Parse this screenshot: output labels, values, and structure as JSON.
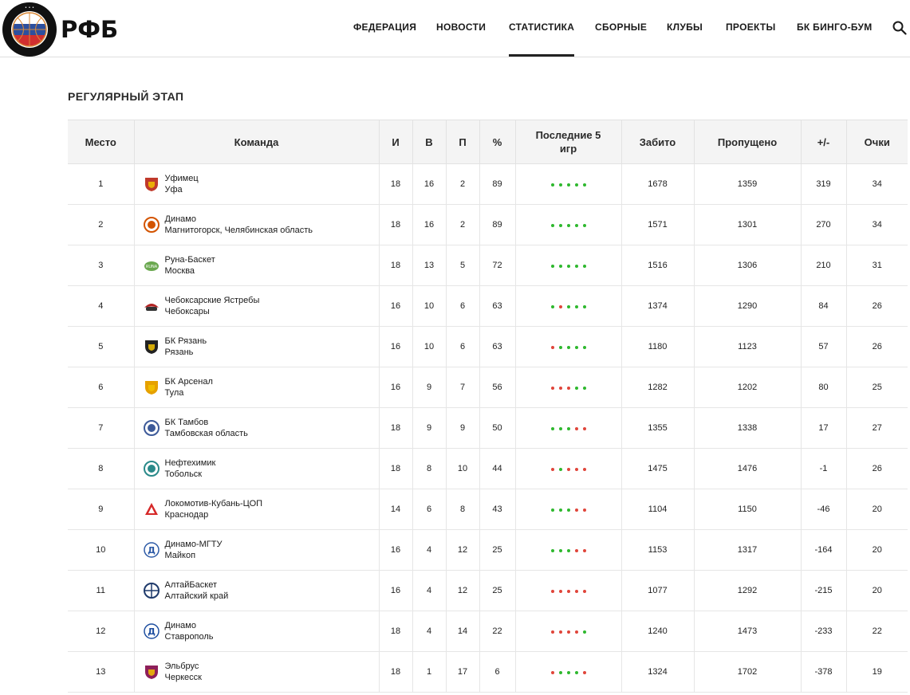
{
  "colors": {
    "win": "#2eb82e",
    "loss": "#e0453a",
    "header_bg": "#f4f4f4",
    "accent": "#222222"
  },
  "header": {
    "logo_text": "РФБ",
    "logo_seal_text": "РОССИЙСКАЯ ФЕДЕРАЦИЯ БАСКЕТБОЛА 1991",
    "nav": [
      {
        "label": "ФЕДЕРАЦИЯ",
        "active": false
      },
      {
        "label": "НОВОСТИ",
        "active": false
      },
      {
        "label": "СТАТИСТИКА",
        "active": true
      },
      {
        "label": "СБОРНЫЕ",
        "active": false
      },
      {
        "label": "КЛУБЫ",
        "active": false
      },
      {
        "label": "ПРОЕКТЫ",
        "active": false
      },
      {
        "label": "БК БИНГО-БУМ",
        "active": false
      }
    ],
    "search_icon": "search-icon"
  },
  "section": {
    "title": "РЕГУЛЯРНЫЙ ЭТАП"
  },
  "table": {
    "columns": [
      "Место",
      "Команда",
      "И",
      "В",
      "П",
      "%",
      "Последние 5 игр",
      "Забито",
      "Пропущено",
      "+/-",
      "Очки"
    ],
    "rows": [
      {
        "place": "1",
        "team": "Уфимец",
        "city": "Уфа",
        "g": "18",
        "w": "16",
        "l": "2",
        "pct": "89",
        "form": [
          "W",
          "W",
          "W",
          "W",
          "W"
        ],
        "scored": "1678",
        "allowed": "1359",
        "diff": "319",
        "pts": "34"
      },
      {
        "place": "2",
        "team": "Динамо",
        "city": "Магнитогорск, Челябинская область",
        "g": "18",
        "w": "16",
        "l": "2",
        "pct": "89",
        "form": [
          "W",
          "W",
          "W",
          "W",
          "W"
        ],
        "scored": "1571",
        "allowed": "1301",
        "diff": "270",
        "pts": "34"
      },
      {
        "place": "3",
        "team": "Руна-Баскет",
        "city": "Москва",
        "g": "18",
        "w": "13",
        "l": "5",
        "pct": "72",
        "form": [
          "W",
          "W",
          "W",
          "W",
          "W"
        ],
        "scored": "1516",
        "allowed": "1306",
        "diff": "210",
        "pts": "31"
      },
      {
        "place": "4",
        "team": "Чебоксарские Ястребы",
        "city": "Чебоксары",
        "g": "16",
        "w": "10",
        "l": "6",
        "pct": "63",
        "form": [
          "W",
          "L",
          "W",
          "W",
          "W"
        ],
        "scored": "1374",
        "allowed": "1290",
        "diff": "84",
        "pts": "26"
      },
      {
        "place": "5",
        "team": "БК Рязань",
        "city": "Рязань",
        "g": "16",
        "w": "10",
        "l": "6",
        "pct": "63",
        "form": [
          "L",
          "W",
          "W",
          "W",
          "W"
        ],
        "scored": "1180",
        "allowed": "1123",
        "diff": "57",
        "pts": "26"
      },
      {
        "place": "6",
        "team": "БК Арсенал",
        "city": "Тула",
        "g": "16",
        "w": "9",
        "l": "7",
        "pct": "56",
        "form": [
          "L",
          "L",
          "L",
          "W",
          "W"
        ],
        "scored": "1282",
        "allowed": "1202",
        "diff": "80",
        "pts": "25"
      },
      {
        "place": "7",
        "team": "БК Тамбов",
        "city": "Тамбовская область",
        "g": "18",
        "w": "9",
        "l": "9",
        "pct": "50",
        "form": [
          "W",
          "W",
          "W",
          "L",
          "L"
        ],
        "scored": "1355",
        "allowed": "1338",
        "diff": "17",
        "pts": "27"
      },
      {
        "place": "8",
        "team": "Нефтехимик",
        "city": "Тобольск",
        "g": "18",
        "w": "8",
        "l": "10",
        "pct": "44",
        "form": [
          "L",
          "W",
          "L",
          "L",
          "L"
        ],
        "scored": "1475",
        "allowed": "1476",
        "diff": "-1",
        "pts": "26"
      },
      {
        "place": "9",
        "team": "Локомотив-Кубань-ЦОП",
        "city": "Краснодар",
        "g": "14",
        "w": "6",
        "l": "8",
        "pct": "43",
        "form": [
          "W",
          "W",
          "W",
          "L",
          "L"
        ],
        "scored": "1104",
        "allowed": "1150",
        "diff": "-46",
        "pts": "20"
      },
      {
        "place": "10",
        "team": "Динамо-МГТУ",
        "city": "Майкоп",
        "g": "16",
        "w": "4",
        "l": "12",
        "pct": "25",
        "form": [
          "W",
          "W",
          "W",
          "L",
          "L"
        ],
        "scored": "1153",
        "allowed": "1317",
        "diff": "-164",
        "pts": "20"
      },
      {
        "place": "11",
        "team": "АлтайБаскет",
        "city": "Алтайский край",
        "g": "16",
        "w": "4",
        "l": "12",
        "pct": "25",
        "form": [
          "L",
          "L",
          "L",
          "L",
          "L"
        ],
        "scored": "1077",
        "allowed": "1292",
        "diff": "-215",
        "pts": "20"
      },
      {
        "place": "12",
        "team": "Динамо",
        "city": "Ставрополь",
        "g": "18",
        "w": "4",
        "l": "14",
        "pct": "22",
        "form": [
          "L",
          "L",
          "L",
          "L",
          "W"
        ],
        "scored": "1240",
        "allowed": "1473",
        "diff": "-233",
        "pts": "22"
      },
      {
        "place": "13",
        "team": "Эльбрус",
        "city": "Черкесск",
        "g": "18",
        "w": "1",
        "l": "17",
        "pct": "6",
        "form": [
          "L",
          "W",
          "W",
          "W",
          "L"
        ],
        "scored": "1324",
        "allowed": "1702",
        "diff": "-378",
        "pts": "19"
      }
    ]
  },
  "team_logos": [
    {
      "icon": "ufimets-logo-icon",
      "color": "#c0392b"
    },
    {
      "icon": "dinamo-mgn-logo-icon",
      "color": "#d35400"
    },
    {
      "icon": "runa-logo-icon",
      "color": "#6aa84f"
    },
    {
      "icon": "cheboksary-hawks-logo-icon",
      "color": "#b22222"
    },
    {
      "icon": "bk-ryazan-logo-icon",
      "color": "#222222"
    },
    {
      "icon": "bk-arsenal-logo-icon",
      "color": "#e6a100"
    },
    {
      "icon": "bk-tambov-logo-icon",
      "color": "#3d5a99"
    },
    {
      "icon": "neftekhimik-logo-icon",
      "color": "#2a8a8a"
    },
    {
      "icon": "lokomotiv-kuban-logo-icon",
      "color": "#d62828"
    },
    {
      "icon": "dinamo-mgtu-logo-icon",
      "color": "#2d5aa6"
    },
    {
      "icon": "altaibasket-logo-icon",
      "color": "#1f3a6b"
    },
    {
      "icon": "dinamo-stavropol-logo-icon",
      "color": "#1f4fa0"
    },
    {
      "icon": "elbrus-logo-icon",
      "color": "#8e1f5a"
    }
  ]
}
